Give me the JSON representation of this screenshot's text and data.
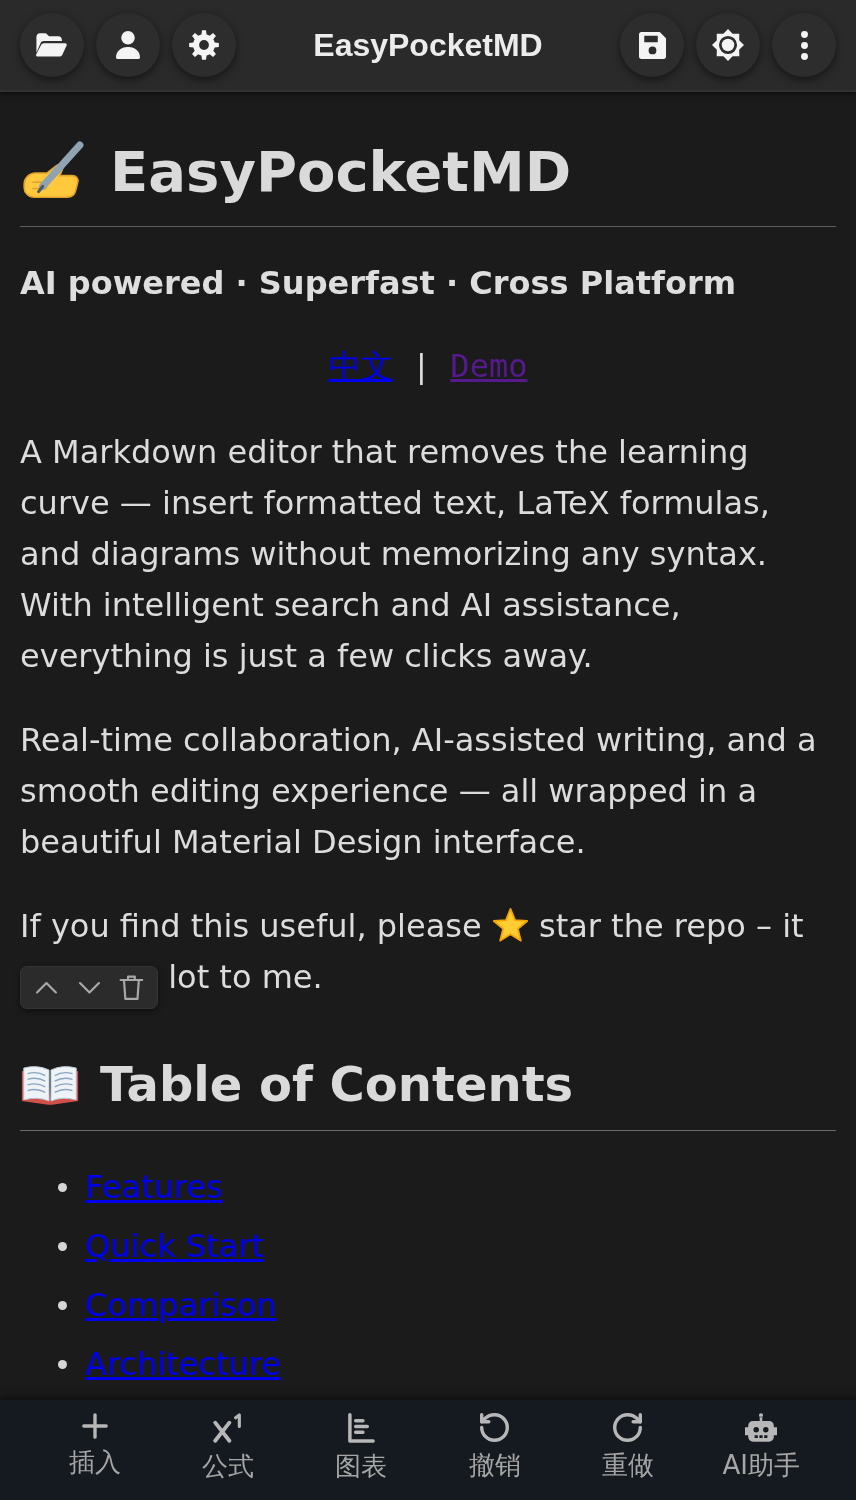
{
  "app_bar": {
    "title": "EasyPocketMD",
    "leading_actions": [
      {
        "kind": "folder"
      },
      {
        "kind": "profile"
      },
      {
        "kind": "settings"
      }
    ],
    "trailing_actions": [
      {
        "kind": "save"
      },
      {
        "kind": "theme"
      },
      {
        "kind": "more"
      }
    ]
  },
  "document": {
    "title": "EasyPocketMD",
    "tagline": "AI powered · Superfast · Cross Platform",
    "links": [
      {
        "label": "中文",
        "visited": false
      },
      {
        "label": "Demo",
        "visited": true
      }
    ],
    "link_separator": "|",
    "paragraphs": [
      "A Markdown editor that removes the learning curve — insert formatted text, LaTeX formulas, and diagrams without memorizing any syntax. With intelligent search and AI assistance, everything is just a few clicks away.",
      "Real-time collaboration, AI-assisted writing, and a smooth editing experience — all wrapped in a beautiful Material Design interface."
    ],
    "support_note": {
      "text": "If you find this useful, please",
      "text_after_icon": "star the repo – it",
      "toolbar": [
        {
          "kind": "up"
        },
        {
          "kind": "down"
        },
        {
          "kind": "delete"
        }
      ],
      "text_after_toolbar": "lot to me."
    },
    "toc": {
      "heading": "Table of Contents",
      "items": [
        {
          "label": "Features"
        },
        {
          "label": "Quick Start"
        },
        {
          "label": "Comparison"
        },
        {
          "label": "Architecture"
        }
      ]
    }
  },
  "bottom_nav": [
    {
      "kind": "insert",
      "label": "插入"
    },
    {
      "kind": "formula",
      "label": "公式"
    },
    {
      "kind": "chart",
      "label": "图表"
    },
    {
      "kind": "undo",
      "label": "撤销"
    },
    {
      "kind": "redo",
      "label": "重做"
    },
    {
      "kind": "assistant",
      "label": "AI助手"
    }
  ]
}
